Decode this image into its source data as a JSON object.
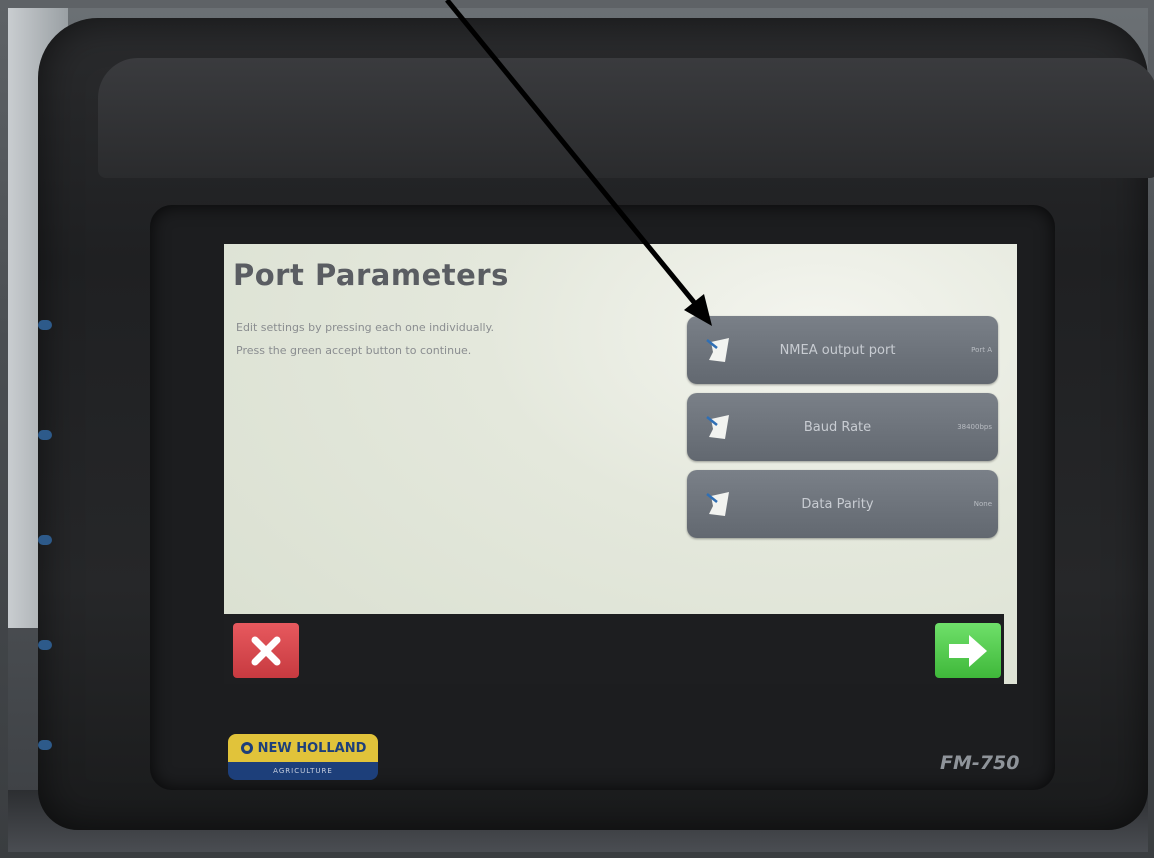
{
  "screen": {
    "title": "Port Parameters",
    "instructions": [
      "Edit settings by pressing each one individually.",
      "Press the green accept button to continue."
    ],
    "parameters": [
      {
        "label": "NMEA output port",
        "value": "Port A"
      },
      {
        "label": "Baud Rate",
        "value": "38400bps"
      },
      {
        "label": "Data Parity",
        "value": "None"
      }
    ]
  },
  "bottom_bar": {
    "cancel_icon": "x-icon",
    "accept_icon": "arrow-right-icon"
  },
  "device": {
    "brand_name": "NEW HOLLAND",
    "brand_subtitle": "AGRICULTURE",
    "model": "FM-750"
  },
  "colors": {
    "screen_background": "#e4e8dc",
    "title": "#5a5d62",
    "param_button": "#6e747c",
    "cancel_button": "#d9464b",
    "accept_button": "#52c94c",
    "brand_yellow": "#e1c33a",
    "brand_blue": "#1d3f7a",
    "annotation_arrow": "#000000"
  }
}
